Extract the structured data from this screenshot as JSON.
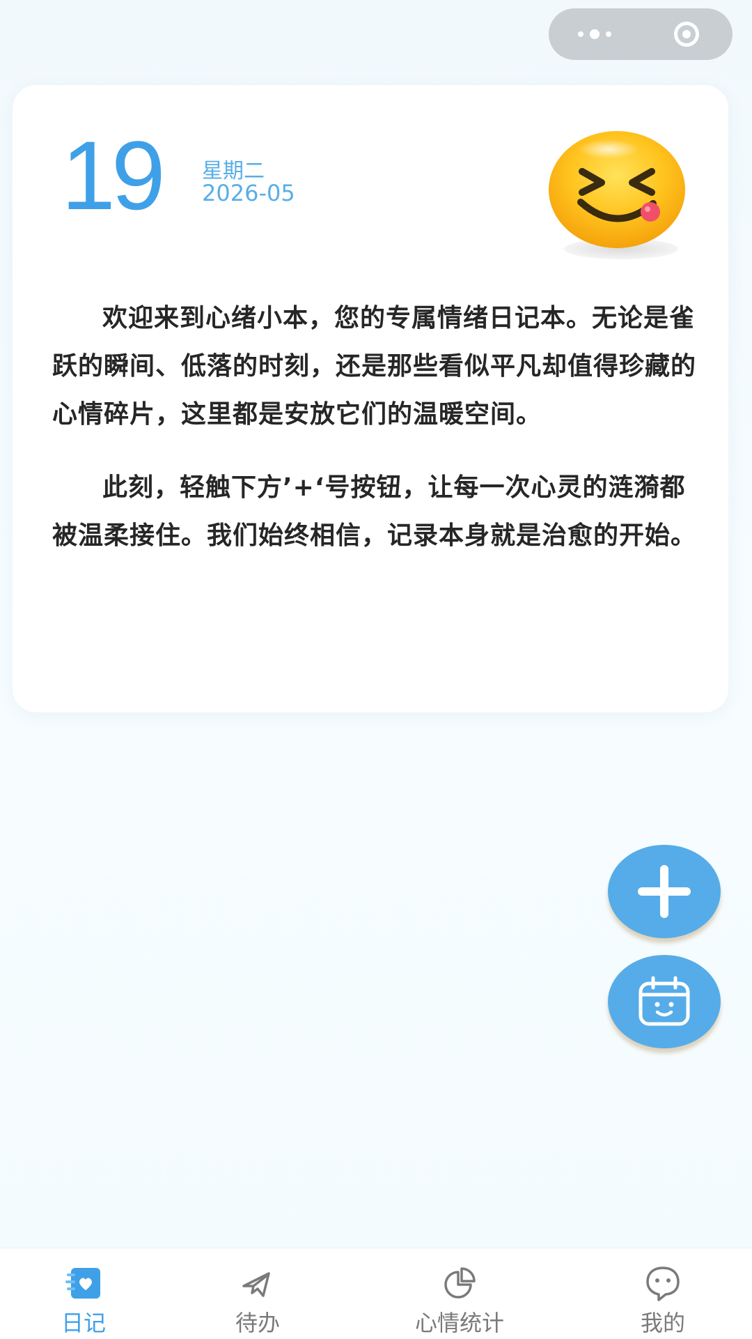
{
  "date": {
    "day": "19",
    "weekday": "星期二",
    "year_month": "2026-05"
  },
  "mood_icon": "laughing-tongue-emoji",
  "intro": {
    "paragraph1": "欢迎来到心绪小本，您的专属情绪日记本。无论是雀跃的瞬间、低落的时刻，还是那些看似平凡却值得珍藏的心情碎片，这里都是安放它们的温暖空间。",
    "paragraph2": "此刻，轻触下方’+‘号按钮，让每一次心灵的涟漪都被温柔接住。我们始终相信，记录本身就是治愈的开始。"
  },
  "capsule": {
    "more_icon": "more-dots-icon",
    "close_icon": "close-ring-icon"
  },
  "fab": {
    "add_icon": "plus-icon",
    "calendar_icon": "calendar-smile-icon"
  },
  "tabs": [
    {
      "label": "日记",
      "icon": "diary-heart-icon",
      "active": true
    },
    {
      "label": "待办",
      "icon": "plane-icon",
      "active": false
    },
    {
      "label": "心情统计",
      "icon": "pie-chart-icon",
      "active": false
    },
    {
      "label": "我的",
      "icon": "chat-face-icon",
      "active": false
    }
  ],
  "colors": {
    "accent": "#3fa0e7",
    "fab": "#55ace8",
    "background": "#f4fbfe"
  }
}
